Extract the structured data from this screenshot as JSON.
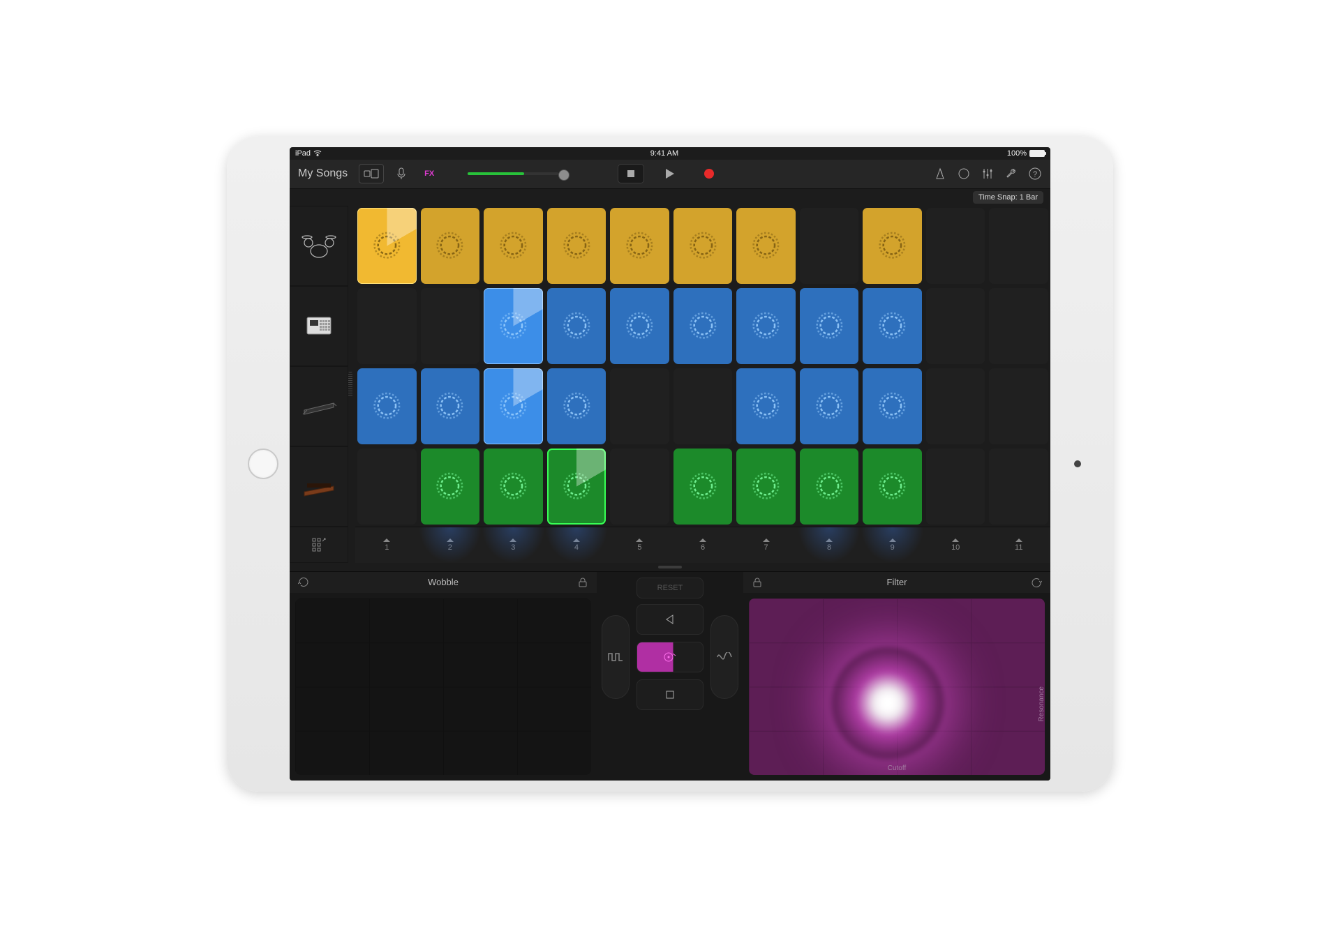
{
  "status": {
    "device": "iPad",
    "time": "9:41 AM",
    "battery_pct": "100%"
  },
  "toolbar": {
    "title": "My Songs",
    "fx_label": "FX",
    "timesnap": "Time Snap: 1 Bar"
  },
  "tracks": [
    {
      "name": "drums",
      "icon": "drumkit-icon"
    },
    {
      "name": "sampler",
      "icon": "mpc-icon"
    },
    {
      "name": "keys",
      "icon": "keyboard-icon"
    },
    {
      "name": "synth",
      "icon": "synth-icon"
    }
  ],
  "grid": {
    "columns": 11,
    "rows": [
      {
        "color": "yellow",
        "cells": [
          {
            "f": 1,
            "a": 1
          },
          {
            "f": 1
          },
          {
            "f": 1
          },
          {
            "f": 1
          },
          {
            "f": 1
          },
          {
            "f": 1
          },
          {
            "f": 1
          },
          {
            "f": 0
          },
          {
            "f": 1
          },
          {
            "f": 0
          },
          {
            "f": 0
          }
        ]
      },
      {
        "color": "blue",
        "cells": [
          {
            "f": 0
          },
          {
            "f": 0
          },
          {
            "f": 1,
            "a": 1
          },
          {
            "f": 1
          },
          {
            "f": 1
          },
          {
            "f": 1
          },
          {
            "f": 1
          },
          {
            "f": 1
          },
          {
            "f": 1
          },
          {
            "f": 0
          },
          {
            "f": 0
          }
        ]
      },
      {
        "color": "blue",
        "cells": [
          {
            "f": 1
          },
          {
            "f": 1
          },
          {
            "f": 1,
            "a": 1
          },
          {
            "f": 1
          },
          {
            "f": 0
          },
          {
            "f": 0
          },
          {
            "f": 1
          },
          {
            "f": 1
          },
          {
            "f": 1
          },
          {
            "f": 0
          },
          {
            "f": 0
          }
        ]
      },
      {
        "color": "green",
        "cells": [
          {
            "f": 0
          },
          {
            "f": 1
          },
          {
            "f": 1
          },
          {
            "f": 1,
            "a": 1
          },
          {
            "f": 0
          },
          {
            "f": 1
          },
          {
            "f": 1
          },
          {
            "f": 1
          },
          {
            "f": 1
          },
          {
            "f": 0
          },
          {
            "f": 0
          }
        ]
      }
    ],
    "footer_numbers": [
      "1",
      "2",
      "3",
      "4",
      "5",
      "6",
      "7",
      "8",
      "9",
      "10",
      "11"
    ],
    "footer_glow": [
      false,
      true,
      true,
      true,
      false,
      false,
      false,
      true,
      true,
      false,
      false
    ]
  },
  "fx": {
    "left": {
      "title": "Wobble"
    },
    "right": {
      "title": "Filter",
      "xaxis": "Cutoff",
      "yaxis": "Resonance"
    },
    "mid": {
      "reset": "RESET"
    }
  },
  "colors": {
    "yellow": "#d3a32c",
    "blue": "#2e70bd",
    "green": "#1c8a2a",
    "magenta": "#e03bd2"
  }
}
